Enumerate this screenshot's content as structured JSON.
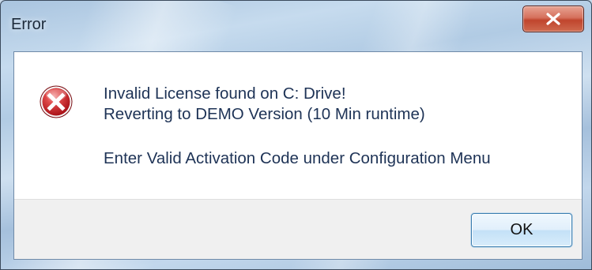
{
  "window": {
    "title": "Error",
    "close_icon": "close-icon"
  },
  "message": {
    "icon": "error-icon",
    "line1": "Invalid License found on C: Drive!",
    "line2": "Reverting to DEMO Version (10 Min runtime)",
    "line3": "Enter Valid Activation Code under Configuration Menu"
  },
  "buttons": {
    "ok_label": "OK"
  },
  "colors": {
    "close_button": "#c0452d",
    "error_icon": "#c4161c",
    "text": "#1e3356"
  }
}
